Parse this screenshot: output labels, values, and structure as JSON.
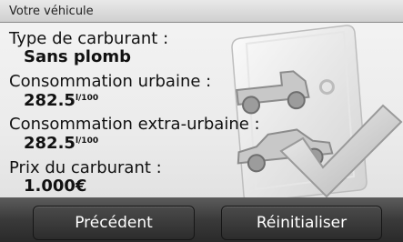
{
  "header": {
    "title": "Votre véhicule"
  },
  "fields": [
    {
      "label": "Type de carburant :",
      "value": "Sans plomb"
    },
    {
      "label": "Consommation urbaine :",
      "value": "282.5",
      "unit": "l/100"
    },
    {
      "label": "Consommation extra-urbaine :",
      "value": "282.5",
      "unit": "l/100"
    },
    {
      "label": "Prix du carburant :",
      "value": "1.000€"
    }
  ],
  "buttons": {
    "previous": "Précédent",
    "reset": "Réinitialiser"
  },
  "illustration": {
    "icon": "vehicle-checklist-icon"
  }
}
